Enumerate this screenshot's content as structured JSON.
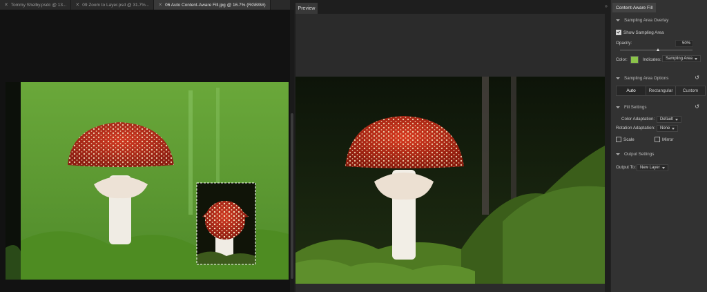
{
  "tabs": [
    {
      "label": "Tommy Shelby.psdc @ 13...",
      "active": false
    },
    {
      "label": "09 Zoom to Layer.psd @ 31.7%...",
      "active": false
    },
    {
      "label": "06 Auto Content-Aware Fill.jpg @ 16.7% (RGB/8#)",
      "active": true
    }
  ],
  "preview": {
    "tab_label": "Preview"
  },
  "panel": {
    "title": "Content-Aware Fill",
    "sampling_overlay": {
      "header": "Sampling Area Overlay",
      "show_label": "Show Sampling Area",
      "opacity_label": "Opacity:",
      "opacity_value": "50%",
      "opacity_fraction": 0.5,
      "color_label": "Color:",
      "swatch_color": "#8bc34a",
      "indicates_label": "Indicates:",
      "indicates_value": "Sampling Area"
    },
    "sampling_options": {
      "header": "Sampling Area Options",
      "buttons": [
        "Auto",
        "Rectangular",
        "Custom"
      ],
      "selected": "Auto"
    },
    "fill_settings": {
      "header": "Fill Settings",
      "color_adaptation_label": "Color Adaptation:",
      "color_adaptation_value": "Default",
      "rotation_adaptation_label": "Rotation Adaptation:",
      "rotation_adaptation_value": "None",
      "scale_label": "Scale",
      "mirror_label": "Mirror"
    },
    "output_settings": {
      "header": "Output Settings",
      "output_to_label": "Output To:",
      "output_to_value": "New Layer"
    }
  },
  "icons": {
    "reset": "reset-icon",
    "close": "close-icon",
    "collapse": "chevron-down-icon"
  }
}
